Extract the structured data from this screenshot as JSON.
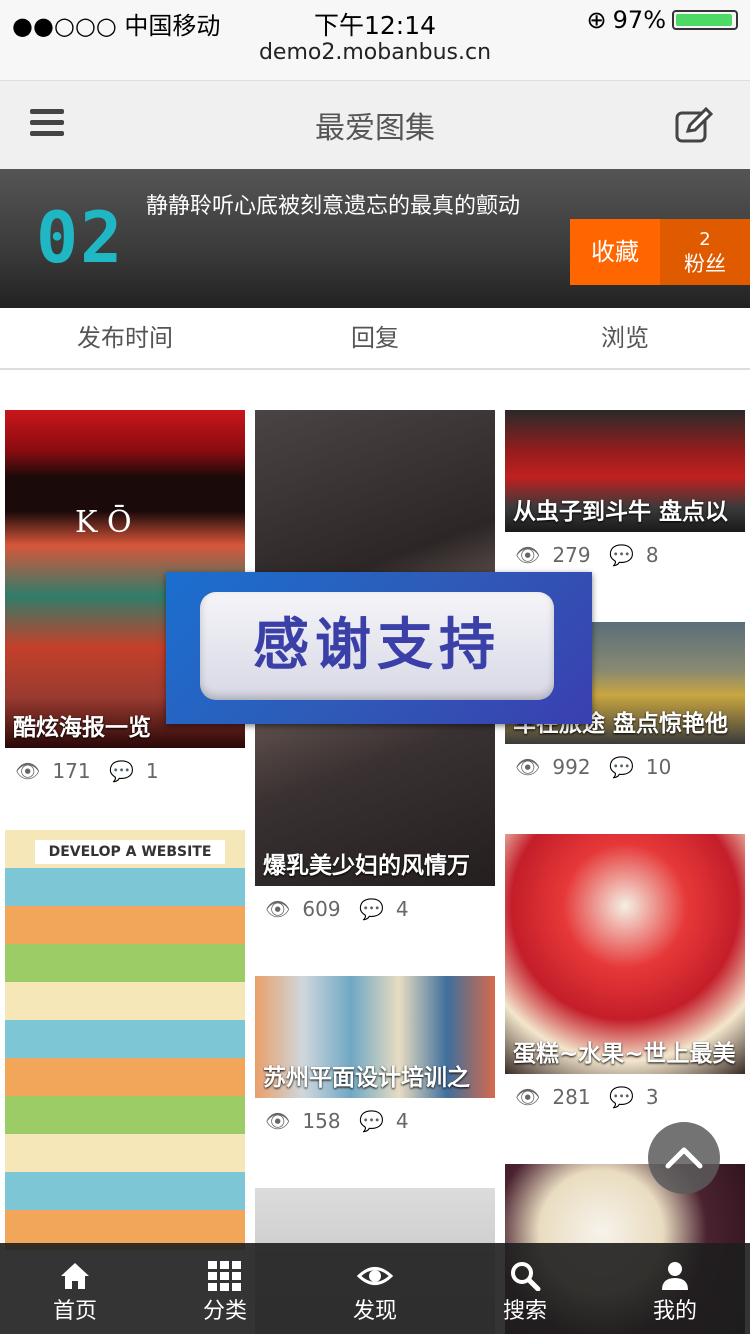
{
  "status_bar": {
    "carrier": "●●○○○ 中国移动",
    "time": "下午12:14",
    "battery": "97%",
    "battery_level": 0.97,
    "url": "demo2.mobanbus.cn"
  },
  "header": {
    "title": "最爱图集",
    "menu_icon": "menu-icon",
    "edit_icon": "edit-icon"
  },
  "banner": {
    "logo": "02",
    "description": "静静聆听心底被刻意遗忘的最真的颤动",
    "favorite_label": "收藏",
    "fans_count": "2",
    "fans_label": "粉丝"
  },
  "sort_tabs": [
    "发布时间",
    "回复",
    "浏览"
  ],
  "cards": [
    {
      "title": "酷炫海报一览",
      "views": "171",
      "comments": "1"
    },
    {
      "title": "从虫子到斗牛 盘点以",
      "views": "279",
      "comments": "8"
    },
    {
      "title": "车在旅途 盘点惊艳他",
      "views": "992",
      "comments": "10"
    },
    {
      "title": "爆乳美少妇的风情万",
      "views": "609",
      "comments": "4"
    },
    {
      "title": "苏州平面设计培训之",
      "views": "158",
      "comments": "4"
    },
    {
      "title": "蛋糕~水果~世上最美",
      "views": "281",
      "comments": "3"
    }
  ],
  "overlay": {
    "text": "感谢支持"
  },
  "bottom_nav": [
    {
      "label": "首页",
      "icon": "home-icon"
    },
    {
      "label": "分类",
      "icon": "grid-icon"
    },
    {
      "label": "发现",
      "icon": "eye-icon"
    },
    {
      "label": "搜索",
      "icon": "search-icon"
    },
    {
      "label": "我的",
      "icon": "user-icon"
    }
  ],
  "colors": {
    "accent": "#ff6600",
    "logo": "#1fb7c4",
    "overlay_text": "#3a40a8"
  }
}
